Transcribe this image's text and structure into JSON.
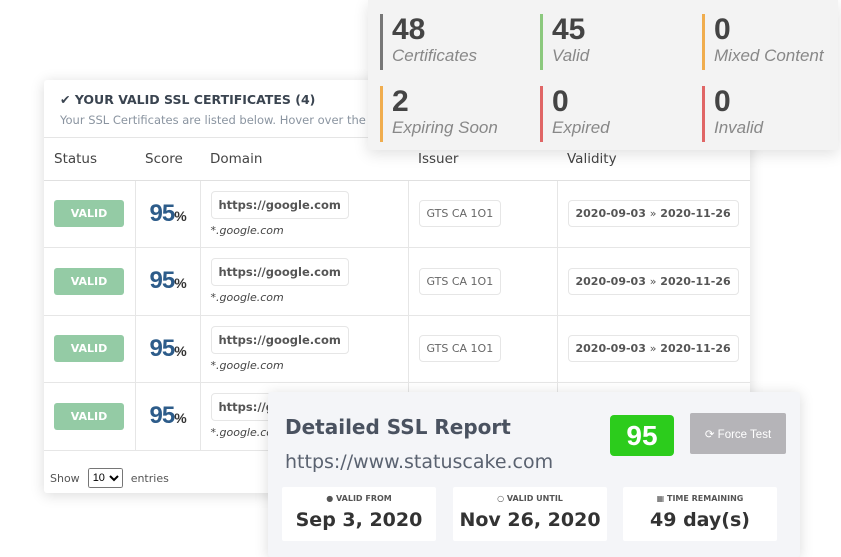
{
  "certs": {
    "title": "YOUR VALID SSL CERTIFICATES (4)",
    "subtitle": "Your SSL Certificates are listed below. Hover over the",
    "columns": [
      "Status",
      "Score",
      "Domain",
      "Issuer",
      "Validity"
    ],
    "rows": [
      {
        "status": "VALID",
        "score": "95",
        "pct": "%",
        "domain": "https://google.com",
        "sub": "*.google.com",
        "issuer": "GTS CA 1O1",
        "from": "2020-09-03",
        "sep": "»",
        "to": "2020-11-26"
      },
      {
        "status": "VALID",
        "score": "95",
        "pct": "%",
        "domain": "https://google.com",
        "sub": "*.google.com",
        "issuer": "GTS CA 1O1",
        "from": "2020-09-03",
        "sep": "»",
        "to": "2020-11-26"
      },
      {
        "status": "VALID",
        "score": "95",
        "pct": "%",
        "domain": "https://google.com",
        "sub": "*.google.com",
        "issuer": "GTS CA 1O1",
        "from": "2020-09-03",
        "sep": "»",
        "to": "2020-11-26"
      },
      {
        "status": "VALID",
        "score": "95",
        "pct": "%",
        "domain": "https://google.com",
        "sub": "*.google.com"
      }
    ],
    "footer": {
      "show": "Show",
      "entries_value": "10",
      "entries": "entries"
    }
  },
  "stats": [
    {
      "n": "48",
      "l": "Certificates",
      "color": "#777777"
    },
    {
      "n": "45",
      "l": "Valid",
      "color": "#8cc97e"
    },
    {
      "n": "0",
      "l": "Mixed Content",
      "color": "#f0ad4e"
    },
    {
      "n": "2",
      "l": "Expiring Soon",
      "color": "#f0ad4e"
    },
    {
      "n": "0",
      "l": "Expired",
      "color": "#e06666"
    },
    {
      "n": "0",
      "l": "Invalid",
      "color": "#e06666"
    }
  ],
  "report": {
    "title": "Detailed SSL Report",
    "url": "https://www.statuscake.com",
    "score": "95",
    "force": "Force Test",
    "boxes": [
      {
        "label": "VALID FROM",
        "value": "Sep 3, 2020"
      },
      {
        "label": "VALID UNTIL",
        "value": "Nov 26, 2020"
      },
      {
        "label": "TIME REMAINING",
        "value": "49 day(s)"
      }
    ]
  }
}
